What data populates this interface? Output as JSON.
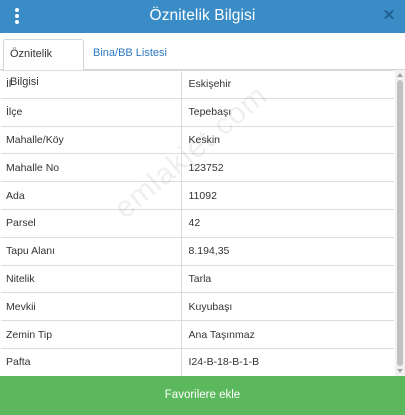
{
  "header": {
    "title": "Öznitelik Bilgisi",
    "menu_icon": "kebab-menu-icon",
    "close_icon": "close-icon",
    "close_glyph": "✕"
  },
  "tabs": [
    {
      "label": "Öznitelik Bilgisi",
      "active": true
    },
    {
      "label": "Bina/BB Listesi",
      "active": false
    }
  ],
  "attributes": [
    {
      "key": "İl",
      "value": "Eskişehir"
    },
    {
      "key": "İlçe",
      "value": "Tepebaşı"
    },
    {
      "key": "Mahalle/Köy",
      "value": "Keskin"
    },
    {
      "key": "Mahalle No",
      "value": "123752"
    },
    {
      "key": "Ada",
      "value": "11092"
    },
    {
      "key": "Parsel",
      "value": "42"
    },
    {
      "key": "Tapu Alanı",
      "value": "8.194,35"
    },
    {
      "key": "Nitelik",
      "value": "Tarla"
    },
    {
      "key": "Mevkii",
      "value": "Kuyubaşı"
    },
    {
      "key": "Zemin Tip",
      "value": "Ana Taşınmaz"
    },
    {
      "key": "Pafta",
      "value": "I24-B-18-B-1-B"
    }
  ],
  "watermark": "emlakjet.com",
  "footer": {
    "button_label": "Favorilere ekle"
  },
  "colors": {
    "header": "#3a8cc7",
    "button": "#5cb85c",
    "link": "#2b79c2"
  }
}
